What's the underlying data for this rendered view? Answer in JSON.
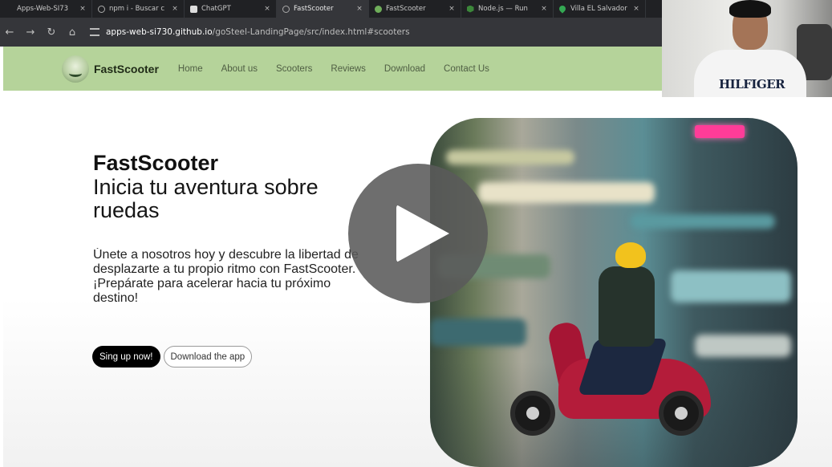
{
  "browser": {
    "tabs": [
      {
        "label": "Apps-Web-SI73",
        "icon": "blank",
        "active": false
      },
      {
        "label": "npm i - Buscar c",
        "icon": "globe",
        "active": false
      },
      {
        "label": "ChatGPT",
        "icon": "chatgpt",
        "active": false
      },
      {
        "label": "FastScooter",
        "icon": "globe",
        "active": true
      },
      {
        "label": "FastScooter",
        "icon": "site",
        "active": false
      },
      {
        "label": "Node.js — Run",
        "icon": "node",
        "active": false
      },
      {
        "label": "Villa EL Salvador",
        "icon": "map-pin",
        "active": false
      }
    ],
    "close_glyph": "×",
    "nav": {
      "back": "←",
      "forward": "→",
      "reload": "↻",
      "home": "⌂"
    },
    "url_host": "apps-web-si730.github.io",
    "url_path": "/goSteel-LandingPage/src/index.html#scooters"
  },
  "site": {
    "brand": "FastScooter",
    "menu": [
      "Home",
      "About us",
      "Scooters",
      "Reviews",
      "Download",
      "Contact Us"
    ],
    "hero": {
      "title": "FastScooter",
      "subtitle": "Inicia tu aventura sobre ruedas",
      "description": "Únete a nosotros hoy y descubre la libertad de desplazarte a tu propio ritmo con FastScooter. ¡Prepárate para acelerar hacia tu próximo destino!",
      "signup_label": "Sing up now!",
      "download_label": "Download the app"
    }
  },
  "webcam": {
    "shirt_text": "HILFIGER"
  },
  "colors": {
    "nav_bg": "#b5d39a",
    "signup_bg": "#000000",
    "play_overlay": "#5a5a5a"
  }
}
